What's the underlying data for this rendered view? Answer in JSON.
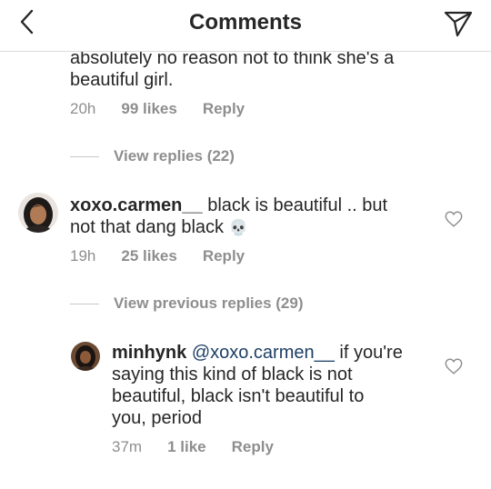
{
  "header": {
    "title": "Comments"
  },
  "comments": [
    {
      "text_line1": "absolutely no reason not to think she's a",
      "text_line2": "beautiful girl.",
      "time": "20h",
      "likes": "99 likes",
      "reply": "Reply",
      "view_replies": "View replies (22)"
    },
    {
      "username": "xoxo.carmen__",
      "text_part1": " black is beautiful .. but",
      "text_line2": "not that dang black",
      "emoji": "💀",
      "time": "19h",
      "likes": "25 likes",
      "reply": "Reply",
      "view_replies": "View previous replies (29)"
    },
    {
      "username": "minhynk",
      "mention": "@xoxo.carmen__",
      "text_part1": " if you're",
      "text_line2": "saying this kind of black is not",
      "text_line3": "beautiful, black isn't beautiful to",
      "text_line4": "you, period",
      "time": "37m",
      "likes": "1 like",
      "reply": "Reply"
    }
  ],
  "icons": {
    "back": "chevron-left-icon",
    "share": "paper-plane-icon",
    "like": "heart-outline-icon"
  },
  "colors": {
    "text": "#262626",
    "secondary": "#8e8e8e",
    "mention": "#1d3f66",
    "divider": "#dbdbdb"
  }
}
